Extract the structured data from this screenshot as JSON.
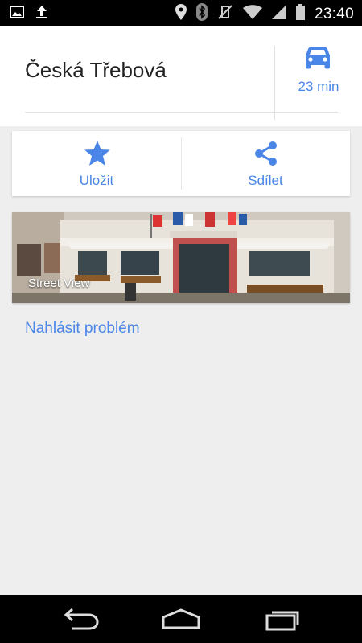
{
  "status_bar": {
    "time": "23:40",
    "left_icons": [
      "image-icon",
      "upload-icon"
    ],
    "right_icons": [
      "location-icon",
      "bluetooth-icon",
      "vibrate-off-icon",
      "wifi-icon",
      "signal-icon",
      "battery-icon"
    ]
  },
  "place": {
    "title": "Česká Třebová"
  },
  "route": {
    "icon": "car-icon",
    "time": "23 min"
  },
  "actions": {
    "save_label": "Uložit",
    "share_label": "Sdílet"
  },
  "street_view": {
    "label": "Street View"
  },
  "report_link": "Nahlásit problém",
  "colors": {
    "accent": "#4a86e8",
    "background": "#eeeeee"
  }
}
